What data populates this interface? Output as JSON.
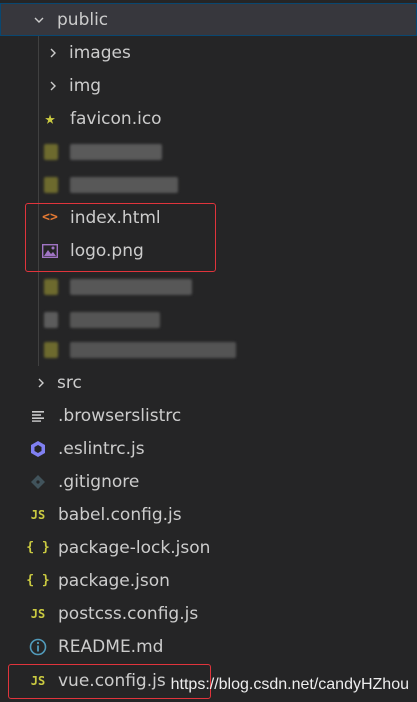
{
  "tree": {
    "folder_public": "public",
    "folder_images": "images",
    "folder_img": "img",
    "file_favicon": "favicon.ico",
    "file_index_html": "index.html",
    "file_logo_png": "logo.png",
    "folder_src": "src",
    "file_browserslistrc": ".browserslistrc",
    "file_eslintrc": ".eslintrc.js",
    "file_gitignore": ".gitignore",
    "file_babel_config": "babel.config.js",
    "file_package_lock": "package-lock.json",
    "file_package_json": "package.json",
    "file_postcss_config": "postcss.config.js",
    "file_readme": "README.md",
    "file_vue_config": "vue.config.js"
  },
  "icons": {
    "js_badge": "JS",
    "json_badge": "{ }",
    "html_badge": "<>",
    "info_badge": "i"
  },
  "watermark": "https://blog.csdn.net/candyHZhou",
  "colors": {
    "background": "#252526",
    "selected": "#37373d",
    "js_yellow": "#cbcb41",
    "html_orange": "#e37933",
    "image_purple": "#a074c4",
    "eslint_purple": "#8080f2",
    "git_gray": "#41535b",
    "readme_blue": "#519aba",
    "highlight_red": "#e0343c"
  }
}
